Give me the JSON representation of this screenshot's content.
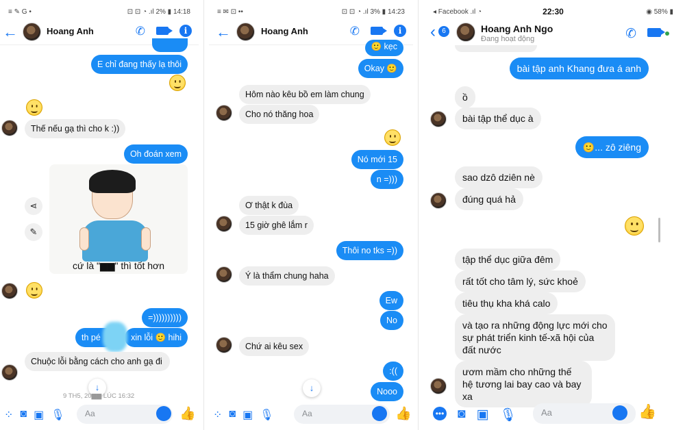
{
  "panel1": {
    "status_left": "≡ ✎ G •",
    "status_right": "⊡ ⊡ ◔ .ıl 2% ▮ 14:18",
    "contact_name": "Hoang Anh",
    "messages": [
      {
        "text": "E chỉ đang thấy lạ thôi"
      },
      {
        "text": "Thế nếu gạ thì cho k :))"
      },
      {
        "text": "Oh đoán xem"
      },
      {
        "text": "=))))))))))"
      },
      {
        "text": "th pé"
      },
      {
        "text": "xin lỗi 🙂 hihi"
      },
      {
        "text": "Chuộc lỗi bằng cách cho anh gạ đi"
      }
    ],
    "sticker_caption": "cứ là \"▆▆\" thì tốt hơn",
    "timestamp": "9 TH5, 20▆▆ LÚC 16:32",
    "composer_placeholder": "Aa"
  },
  "panel2": {
    "status_left": "≡ ✉ ⊡ ••",
    "status_right": "⊡ ⊡ ◔ .ıl 3% ▮ 14:23",
    "contact_name": "Hoang Anh",
    "messages": [
      {
        "text": "🙂 kẹc"
      },
      {
        "text": "Okay 🙂"
      },
      {
        "text": "Hôm nào kêu bồ em làm chung"
      },
      {
        "text": "Cho nó thăng hoa"
      },
      {
        "text": "Nó mới 15"
      },
      {
        "text": "n =)))"
      },
      {
        "text": "Ơ thật k đùa"
      },
      {
        "text": "15 giờ ghê lắm r"
      },
      {
        "text": "Thôi no tks =))"
      },
      {
        "text": "Ý là thẩm chung haha"
      },
      {
        "text": "Ew"
      },
      {
        "text": "No"
      },
      {
        "text": "Chứ ai kêu sex"
      },
      {
        "text": ":(("
      },
      {
        "text": "Nooo"
      }
    ],
    "composer_placeholder": "Aa"
  },
  "panel3": {
    "status_left": "◂ Facebook .ıl ◔",
    "status_time": "22:30",
    "status_right": "◉ 58% ▮",
    "contact_name": "Hoang Anh Ngo",
    "contact_status": "Đang hoạt động",
    "back_badge": "6",
    "messages": [
      {
        "text": "bài tập anh Khang đưa á anh"
      },
      {
        "text": "ồ"
      },
      {
        "text": "bài tập thể dục à"
      },
      {
        "text": "🙂... zô ziêng"
      },
      {
        "text": "sao dzô dziên nè"
      },
      {
        "text": "đúng quá hả"
      },
      {
        "text": "tập thể dục giữa đêm"
      },
      {
        "text": "rất tốt cho tâm lý, sức khoẻ"
      },
      {
        "text": "tiêu thụ kha khá calo"
      },
      {
        "text": "và tạo ra những động lực mới cho sự phát triển kinh tế-xã hội của đất nước"
      },
      {
        "text": "ươm mầm cho những thế hệ tương lai bay cao và bay xa"
      }
    ],
    "composer_placeholder": "Aa"
  },
  "colors": {
    "messenger_blue": "#1a8cf5",
    "incoming_bubble": "#eeeeee",
    "accent": "#1877f2",
    "online_dot": "#31a24c"
  },
  "icons": [
    "back-arrow-icon",
    "phone-icon",
    "video-camera-icon",
    "info-icon",
    "share-icon",
    "pencil-icon",
    "apps-icon",
    "camera-icon",
    "image-icon",
    "microphone-icon",
    "emoji-icon",
    "thumbs-up-icon",
    "chevron-down-icon",
    "more-icon"
  ]
}
